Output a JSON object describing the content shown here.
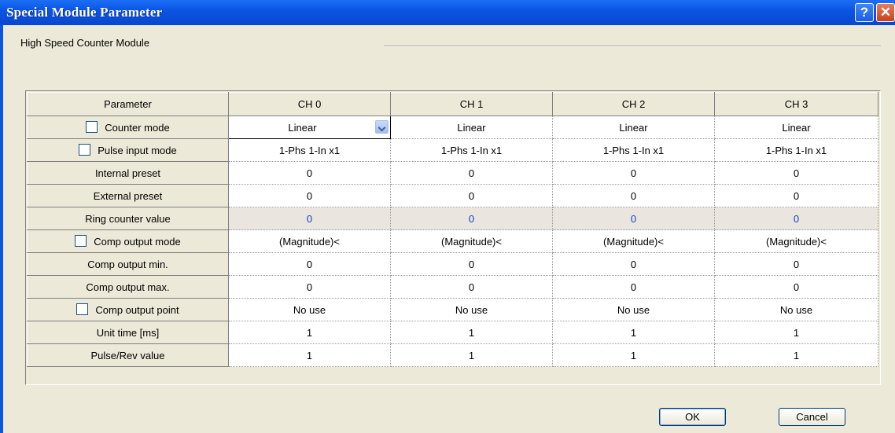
{
  "window": {
    "title": "Special Module Parameter",
    "help_label": "?",
    "close_label": "✕"
  },
  "group": {
    "label": "High Speed Counter Module"
  },
  "grid": {
    "header": [
      "Parameter",
      "CH 0",
      "CH 1",
      "CH 2",
      "CH 3"
    ],
    "rows": [
      {
        "param": "Counter mode",
        "checkbox": true,
        "values": [
          "Linear",
          "Linear",
          "Linear",
          "Linear"
        ]
      },
      {
        "param": "Pulse input mode",
        "checkbox": true,
        "values": [
          "1-Phs 1-In x1",
          "1-Phs 1-In x1",
          "1-Phs 1-In x1",
          "1-Phs 1-In x1"
        ]
      },
      {
        "param": "Internal preset",
        "checkbox": false,
        "values": [
          "0",
          "0",
          "0",
          "0"
        ]
      },
      {
        "param": "External preset",
        "checkbox": false,
        "values": [
          "0",
          "0",
          "0",
          "0"
        ]
      },
      {
        "param": "Ring counter value",
        "checkbox": false,
        "values": [
          "0",
          "0",
          "0",
          "0"
        ]
      },
      {
        "param": "Comp output mode",
        "checkbox": true,
        "values": [
          "(Magnitude)<",
          "(Magnitude)<",
          "(Magnitude)<",
          "(Magnitude)<"
        ]
      },
      {
        "param": "Comp output min.",
        "checkbox": false,
        "values": [
          "0",
          "0",
          "0",
          "0"
        ]
      },
      {
        "param": "Comp output max.",
        "checkbox": false,
        "values": [
          "0",
          "0",
          "0",
          "0"
        ]
      },
      {
        "param": "Comp output point",
        "checkbox": true,
        "values": [
          "No use",
          "No use",
          "No use",
          "No use"
        ]
      },
      {
        "param": "Unit time [ms]",
        "checkbox": false,
        "values": [
          "1",
          "1",
          "1",
          "1"
        ]
      },
      {
        "param": "Pulse/Rev value",
        "checkbox": false,
        "values": [
          "1",
          "1",
          "1",
          "1"
        ]
      }
    ]
  },
  "buttons": {
    "ok": "OK",
    "cancel": "Cancel"
  },
  "colors": {
    "titlebar": "#0b55e4",
    "dialog_bg": "#ece9d8",
    "ring_value": "#1a3ccc"
  }
}
